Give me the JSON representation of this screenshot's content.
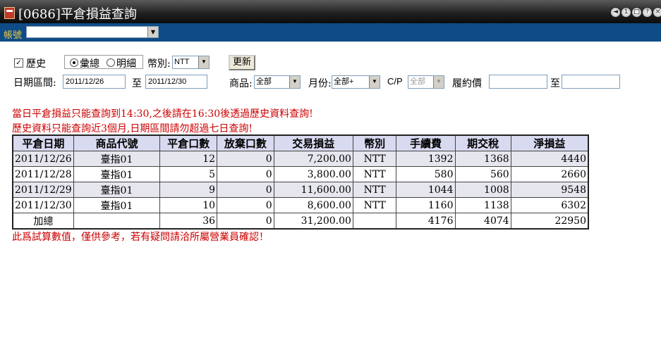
{
  "window": {
    "title": "[0686]平倉損益查詢",
    "buttons": [
      "◄",
      "1",
      "□",
      "?",
      "×"
    ]
  },
  "account": {
    "label": "帳號",
    "value": ""
  },
  "filters": {
    "history_label": "歷史",
    "history_checked": true,
    "radio_total": "彙總",
    "radio_detail": "明細",
    "currency_label": "幣別:",
    "currency_value": "NTT",
    "refresh_button": "更新",
    "date_range_label": "日期區間:",
    "date_from": "2011/12/26",
    "to_label": "至",
    "date_to": "2011/12/30",
    "product_label": "商品:",
    "product_value": "全部",
    "month_label": "月份:",
    "month_value": "全部+",
    "cp_label": "C/P",
    "cp_value": "全部",
    "strike_label": "履約價",
    "strike_from": "",
    "strike_to_label": "至",
    "strike_to": ""
  },
  "notices": {
    "line1": "當日平倉損益只能查詢到14:30,之後請在16:30後透過歷史資料查詢!",
    "line2": "歷史資料只能查詢近3個月,日期區間請勿超過七日查詢!",
    "footer": "此爲試算數值，僅供參考，若有疑問請洽所屬營業員確認！"
  },
  "table": {
    "headers": [
      "平倉日期",
      "商品代號",
      "平倉口數",
      "放棄口數",
      "交易損益",
      "幣別",
      "手續費",
      "期交稅",
      "淨損益"
    ],
    "rows": [
      [
        "2011/12/26",
        "臺指01",
        "12",
        "0",
        "7,200.00",
        "NTT",
        "1392",
        "1368",
        "4440"
      ],
      [
        "2011/12/28",
        "臺指01",
        "5",
        "0",
        "3,800.00",
        "NTT",
        "580",
        "560",
        "2660"
      ],
      [
        "2011/12/29",
        "臺指01",
        "9",
        "0",
        "11,600.00",
        "NTT",
        "1044",
        "1008",
        "9548"
      ],
      [
        "2011/12/30",
        "臺指01",
        "10",
        "0",
        "8,600.00",
        "NTT",
        "1160",
        "1138",
        "6302"
      ]
    ],
    "total": [
      "加總",
      "",
      "36",
      "0",
      "31,200.00",
      "",
      "4176",
      "4074",
      "22950"
    ]
  }
}
